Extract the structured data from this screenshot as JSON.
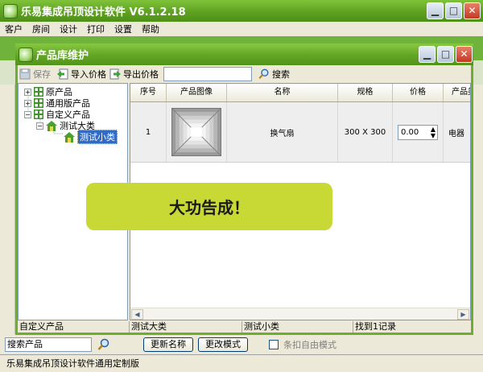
{
  "app": {
    "title": "乐易集成吊顶设计软件 V6.1.2.18",
    "status": "乐易集成吊顶设计软件通用定制版"
  },
  "menu": [
    "客户",
    "房间",
    "设计",
    "打印",
    "设置",
    "帮助"
  ],
  "main_bottom": {
    "search_value": "搜索产品",
    "rename_label": "更新名称",
    "mode_label": "更改模式",
    "free_mode_label": "条扣自由模式"
  },
  "dialog": {
    "title": "产品库维护",
    "toolbar": {
      "save": "保存",
      "import": "导入价格",
      "export": "导出价格",
      "search": "搜索"
    },
    "tree": [
      {
        "label": "原产品",
        "expander": "+"
      },
      {
        "label": "通用版产品",
        "expander": "+"
      },
      {
        "label": "自定义产品",
        "expander": "−"
      },
      {
        "label": "测试大类",
        "expander": "−"
      },
      {
        "label": "测试小类"
      }
    ],
    "table": {
      "headers": [
        "序号",
        "产品图像",
        "名称",
        "规格",
        "价格",
        "产品类"
      ],
      "row": {
        "index": "1",
        "name": "换气扇",
        "spec": "300 X 300",
        "price": "0.00",
        "category": "电器"
      }
    },
    "status": [
      "自定义产品",
      "测试大类",
      "测试小类",
      "找到1记录"
    ]
  },
  "toast": {
    "message": "大功告成！"
  },
  "colors": {
    "accent": "#6dae31",
    "toast": "#c8d935"
  }
}
